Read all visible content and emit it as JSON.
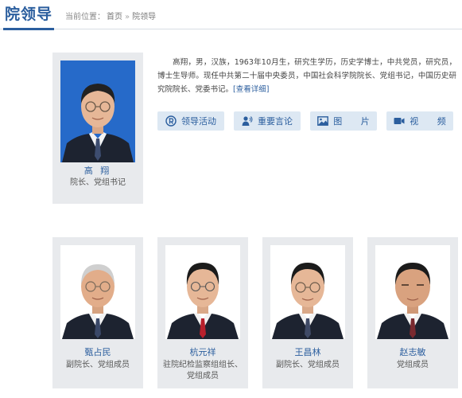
{
  "header": {
    "title": "院领导",
    "breadcrumb_prefix": "当前位置：",
    "breadcrumb_home": "首页",
    "breadcrumb_sep": "»",
    "breadcrumb_current": "院领导"
  },
  "leader": {
    "name": "高 翔",
    "role": "院长、党组书记",
    "bio": "高翔，男，汉族，1963年10月生，研究生学历，历史学博士，中共党员，研究员，博士生导师。现任中共第二十届中央委员，中国社会科学院院长、党组书记，中国历史研究院院长、党委书记。",
    "more_label": "[查看详细]"
  },
  "buttons": [
    {
      "label": "领导活动",
      "icon": "activity-icon"
    },
    {
      "label": "重要言论",
      "icon": "speech-icon"
    },
    {
      "label": "图  片",
      "icon": "picture-icon"
    },
    {
      "label": "视  频",
      "icon": "video-icon"
    }
  ],
  "members": [
    {
      "name": "甄占民",
      "role": "副院长、党组成员"
    },
    {
      "name": "杭元祥",
      "role": "驻院纪检监察组组长、党组成员"
    },
    {
      "name": "王昌林",
      "role": "副院长、党组成员"
    },
    {
      "name": "赵志敏",
      "role": "党组成员"
    }
  ],
  "colors": {
    "accent": "#2b5e9e",
    "card_bg": "#e8eaed",
    "button_bg": "#dde8f3",
    "photo_bg": "#1e63c4"
  }
}
